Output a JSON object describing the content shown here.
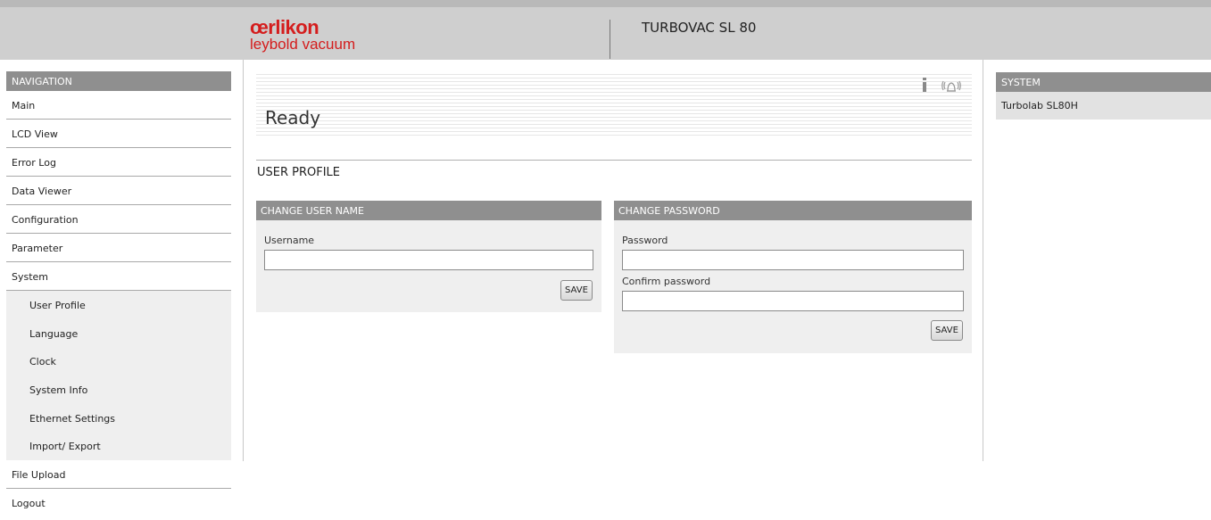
{
  "header": {
    "logo_brand": "œrlikon",
    "logo_sub": "leybold vacuum",
    "product_title": "TURBOVAC SL 80"
  },
  "navigation": {
    "title": "NAVIGATION",
    "items": [
      {
        "label": "Main"
      },
      {
        "label": "LCD View"
      },
      {
        "label": "Error Log"
      },
      {
        "label": "Data Viewer"
      },
      {
        "label": "Configuration"
      },
      {
        "label": "Parameter"
      },
      {
        "label": "System"
      }
    ],
    "system_subitems": [
      {
        "label": "User Profile"
      },
      {
        "label": "Language"
      },
      {
        "label": "Clock"
      },
      {
        "label": "System Info"
      },
      {
        "label": "Ethernet Settings"
      },
      {
        "label": "Import/ Export"
      }
    ],
    "bottom_items": [
      {
        "label": "File Upload"
      },
      {
        "label": "Logout"
      }
    ]
  },
  "status": {
    "text": "Ready",
    "info_icon": "info-icon",
    "alarm_icon": "alarm-bell-icon"
  },
  "page": {
    "section_title": "USER PROFILE"
  },
  "change_user_name": {
    "title": "CHANGE USER NAME",
    "username_label": "Username",
    "username_value": "",
    "save_label": "SAVE"
  },
  "change_password": {
    "title": "CHANGE PASSWORD",
    "password_label": "Password",
    "password_value": "",
    "confirm_label": "Confirm password",
    "confirm_value": "",
    "save_label": "SAVE"
  },
  "system_panel": {
    "title": "SYSTEM",
    "value": "Turbolab SL80H"
  },
  "colors": {
    "brand_red": "#d41d1d",
    "header_bg": "#cfcfcf",
    "section_header_bg": "#8f8f8f",
    "panel_bg": "#efefef"
  }
}
